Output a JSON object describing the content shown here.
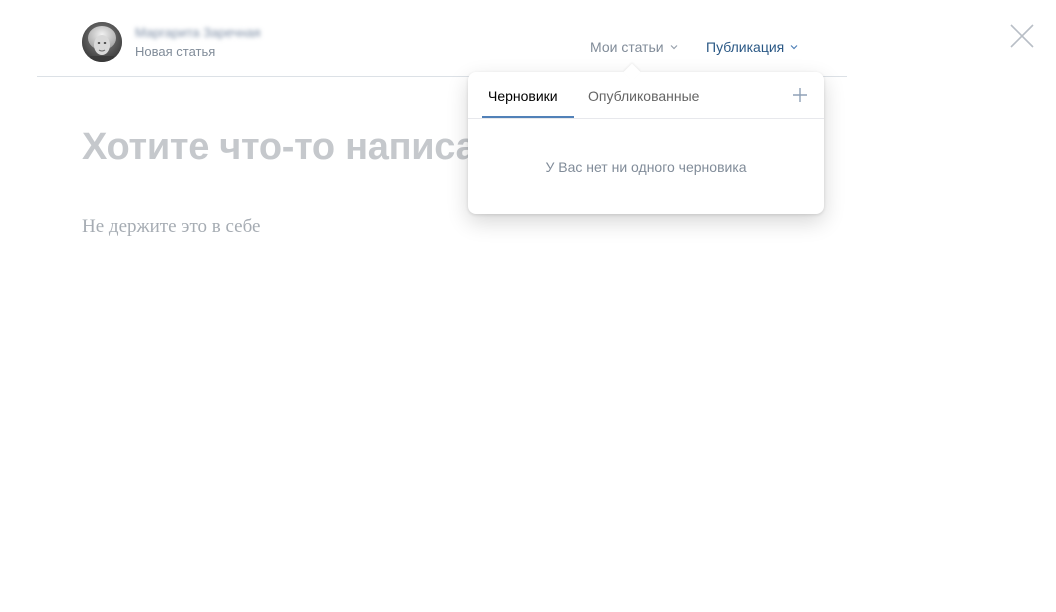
{
  "header": {
    "author_name": "Маргарита Заречная",
    "subtitle": "Новая статья",
    "nav": {
      "my_articles": "Мои статьи",
      "publish": "Публикация"
    }
  },
  "editor": {
    "title_placeholder": "Хотите что-то написа",
    "body_placeholder": "Не держите это в себе"
  },
  "dropdown": {
    "tabs": [
      {
        "label": "Черновики",
        "active": true
      },
      {
        "label": "Опубликованные",
        "active": false
      }
    ],
    "empty_message": "У Вас нет ни одного черновика"
  },
  "icons": {
    "close": "close-icon",
    "add": "plus-icon",
    "chevron": "chevron-down-icon"
  },
  "colors": {
    "link": "#2a5885",
    "accent": "#5181b8",
    "muted": "#818c99",
    "placeholder": "#c5c8cc"
  }
}
